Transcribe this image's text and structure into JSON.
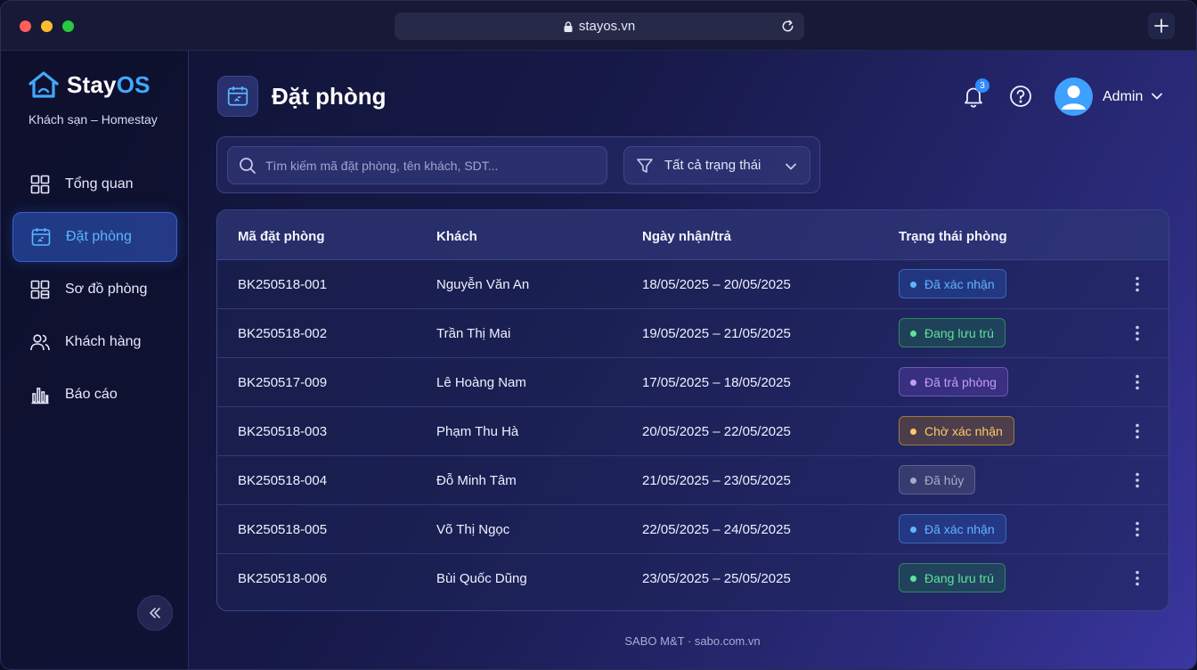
{
  "browser": {
    "url": "stayos.vn"
  },
  "brand": {
    "name_part1": "Stay",
    "name_part2": "OS",
    "subtitle": "Khách sạn – Homestay"
  },
  "sidebar": {
    "items": [
      {
        "label": "Tổng quan",
        "icon": "grid-icon"
      },
      {
        "label": "Đặt phòng",
        "icon": "calendar-icon",
        "active": true
      },
      {
        "label": "Sơ đồ phòng",
        "icon": "layout-icon"
      },
      {
        "label": "Khách hàng",
        "icon": "users-icon"
      },
      {
        "label": "Báo cáo",
        "icon": "bar-chart-icon"
      }
    ]
  },
  "header": {
    "title": "Đặt phòng",
    "notification_count": "3",
    "user_name": "Admin"
  },
  "filters": {
    "search_placeholder": "Tìm kiếm mã đặt phòng, tên khách, SDT...",
    "status_value": "Tất cả trạng thái"
  },
  "table": {
    "columns": [
      "Mã đặt phòng",
      "Khách",
      "Ngày nhận/trả",
      "Trạng thái phòng"
    ],
    "rows": [
      {
        "id": "BK250518-001",
        "guest": "Nguyễn Văn An",
        "dates": "18/05/2025 – 20/05/2025",
        "status": "Đã xác nhận",
        "status_type": "confirmed"
      },
      {
        "id": "BK250518-002",
        "guest": "Trần Thị Mai",
        "dates": "19/05/2025 – 21/05/2025",
        "status": "Đang lưu trú",
        "status_type": "staying"
      },
      {
        "id": "BK250517-009",
        "guest": "Lê Hoàng Nam",
        "dates": "17/05/2025 – 18/05/2025",
        "status": "Đã trả phòng",
        "status_type": "checkedout"
      },
      {
        "id": "BK250518-003",
        "guest": "Phạm Thu Hà",
        "dates": "20/05/2025 – 22/05/2025",
        "status": "Chờ xác nhận",
        "status_type": "pending"
      },
      {
        "id": "BK250518-004",
        "guest": "Đỗ Minh Tâm",
        "dates": "21/05/2025 – 23/05/2025",
        "status": "Đã hủy",
        "status_type": "cancelled"
      },
      {
        "id": "BK250518-005",
        "guest": "Võ Thị Ngọc",
        "dates": "22/05/2025 – 24/05/2025",
        "status": "Đã xác nhận",
        "status_type": "confirmed"
      },
      {
        "id": "BK250518-006",
        "guest": "Bùi Quốc Dũng",
        "dates": "23/05/2025 – 25/05/2025",
        "status": "Đang lưu trú",
        "status_type": "staying"
      }
    ]
  },
  "footer": {
    "text": "SABO M&T · sabo.com.vn"
  },
  "colors": {
    "accent": "#42a8ff",
    "confirmed": "#63b3ff",
    "staying": "#5fe39b",
    "checkedout": "#c39bff",
    "pending": "#ffc86a",
    "cancelled": "#a7acc6"
  }
}
